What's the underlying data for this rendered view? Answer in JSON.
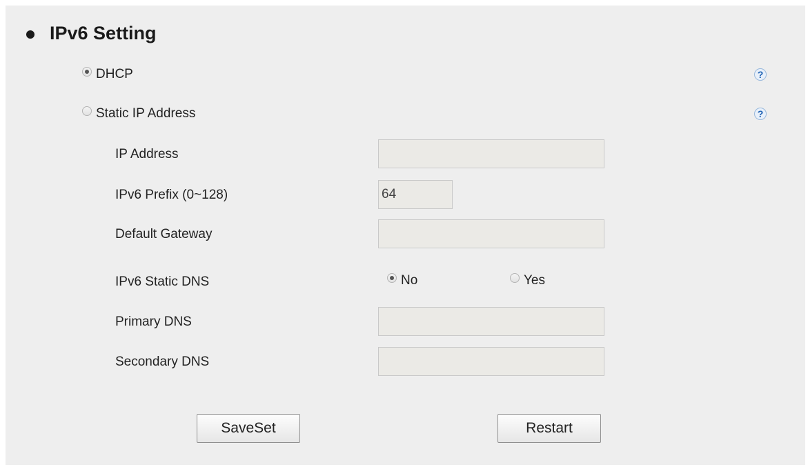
{
  "section": {
    "title": "IPv6 Setting"
  },
  "mode": {
    "dhcp_label": "DHCP",
    "static_label": "Static IP Address",
    "selected": "DHCP"
  },
  "fields": {
    "ip_address": {
      "label": "IP Address",
      "value": ""
    },
    "prefix": {
      "label": "IPv6 Prefix (0~128)",
      "value": "64"
    },
    "gateway": {
      "label": "Default Gateway",
      "value": ""
    },
    "static_dns": {
      "label": "IPv6 Static DNS",
      "no_label": "No",
      "yes_label": "Yes",
      "selected": "No"
    },
    "primary_dns": {
      "label": "Primary DNS",
      "value": ""
    },
    "secondary_dns": {
      "label": "Secondary DNS",
      "value": ""
    }
  },
  "buttons": {
    "save_label": "SaveSet",
    "restart_label": "Restart"
  },
  "help": {
    "glyph": "?"
  },
  "colors": {
    "panel_bg": "#eeeeee",
    "field_bg": "#ebeae6",
    "help_blue": "#1f63b5"
  }
}
